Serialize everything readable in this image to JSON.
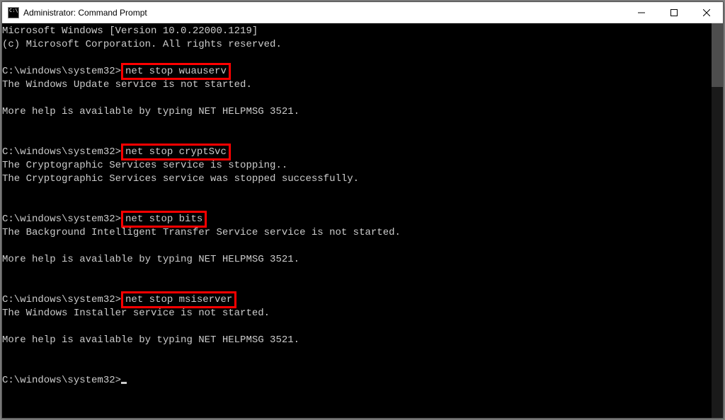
{
  "window": {
    "title": "Administrator: Command Prompt"
  },
  "term": {
    "line01": "Microsoft Windows [Version 10.0.22000.1219]",
    "line02": "(c) Microsoft Corporation. All rights reserved.",
    "prompt": "C:\\windows\\system32>",
    "cmd1": "net stop wuauserv",
    "out1a": "The Windows Update service is not started.",
    "more_help": "More help is available by typing NET HELPMSG 3521.",
    "cmd2": "net stop cryptSvc",
    "out2a": "The Cryptographic Services service is stopping..",
    "out2b": "The Cryptographic Services service was stopped successfully.",
    "cmd3": "net stop bits",
    "out3a": "The Background Intelligent Transfer Service service is not started.",
    "cmd4": "net stop msiserver",
    "out4a": "The Windows Installer service is not started."
  }
}
